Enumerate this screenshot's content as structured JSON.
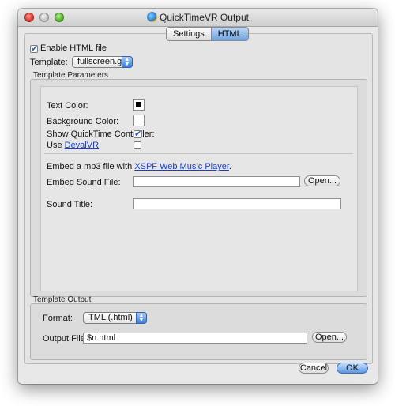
{
  "window": {
    "title": "QuickTimeVR Output"
  },
  "tabs": [
    {
      "label": "Settings"
    },
    {
      "label": "HTML"
    }
  ],
  "html": {
    "enable_label": "Enable HTML file",
    "template_label": "Template:",
    "template_value": "fullscreen.ggt",
    "params": {
      "title": "Template Parameters",
      "text_color_label": "Text Color:",
      "text_color": "#000000",
      "background_color_label": "Background Color:",
      "background_color": "#ffffff",
      "show_controller_label": "Show QuickTime Controller:",
      "use_label": "Use",
      "devalvr_link": "DevalVR",
      "devalvr_colon": ":",
      "embed_text": "Embed a mp3 file with",
      "xspf_link": "XSPF Web Music Player",
      "embed_period": ".",
      "embed_sound_label": "Embed Sound File:",
      "embed_sound_value": "",
      "open_label": "Open...",
      "sound_title_label": "Sound Title:",
      "sound_title_value": ""
    },
    "output": {
      "title": "Template Output",
      "format_label": "Format:",
      "format_value": "TML (.html)",
      "output_file_label": "Output File:",
      "output_file_value": "$n.html",
      "open_label": "Open..."
    }
  },
  "buttons": {
    "cancel": "Cancel",
    "ok": "OK"
  }
}
